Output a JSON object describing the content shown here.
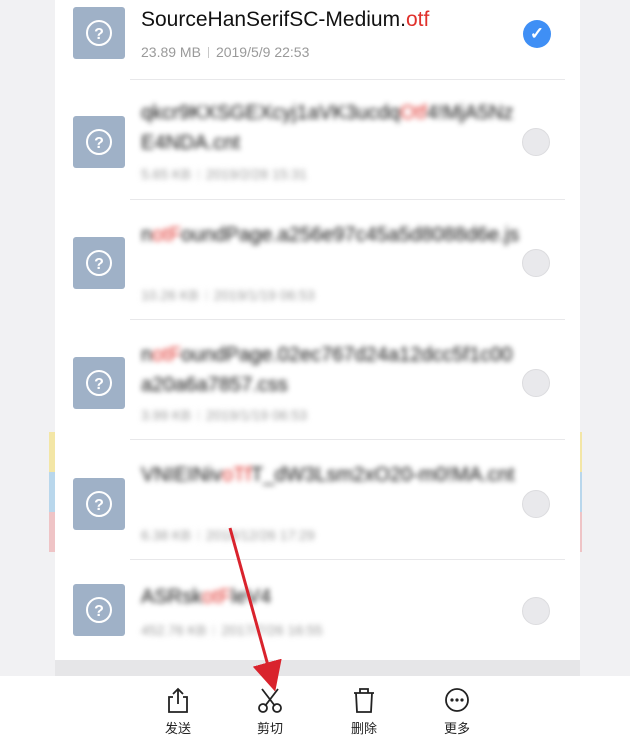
{
  "files": [
    {
      "name_pre": "SourceHanSerifSC-Medium.",
      "name_hl": "otf",
      "name_post": "",
      "size": "23.89 MB",
      "date": "2019/5/9 22:53",
      "selected": true
    },
    {
      "name_pre": "qkcr9KXSGEXcyj1aVK3ucdq",
      "name_hl": "Otf",
      "name_post": "4!MjA5NzE4NDA.cnt",
      "size": "5.65 KB",
      "date": "2019/2/28 15:31",
      "selected": false
    },
    {
      "name_pre": "n",
      "name_hl": "otF",
      "name_post": "oundPage.a256e97c45a5d8088d6e.js",
      "size": "10.26 KB",
      "date": "2019/1/19 06:53",
      "selected": false
    },
    {
      "name_pre": "n",
      "name_hl": "otF",
      "name_post": "oundPage.02ec767d24a12dcc5f1c00a20a6a7857.css",
      "size": "3.99 KB",
      "date": "2019/1/19 06:53",
      "selected": false
    },
    {
      "name_pre": "VNIEINiv",
      "name_hl": "oTf",
      "name_post": "T_dW3Lsm2xO20-m0!MA.cnt",
      "size": "6.38 KB",
      "date": "2018/12/26 17:29",
      "selected": false
    },
    {
      "name_pre": "ASRsk",
      "name_hl": "otF",
      "name_post": "leV4",
      "size": "452.76 KB",
      "date": "2017/7/26 16:55",
      "selected": false
    }
  ],
  "toolbar": {
    "send": "发送",
    "cut": "剪切",
    "delete": "删除",
    "more": "更多"
  },
  "icons": {
    "thumbnail": "question-mark-icon",
    "selected": "checkmark-icon",
    "send": "share-icon",
    "cut": "scissors-icon",
    "delete": "trash-icon",
    "more": "more-dots-icon"
  },
  "colors": {
    "highlight": "#e0312c",
    "check": "#3f8ff5",
    "thumb": "#9fb1c7",
    "arrow": "#d9232d"
  }
}
